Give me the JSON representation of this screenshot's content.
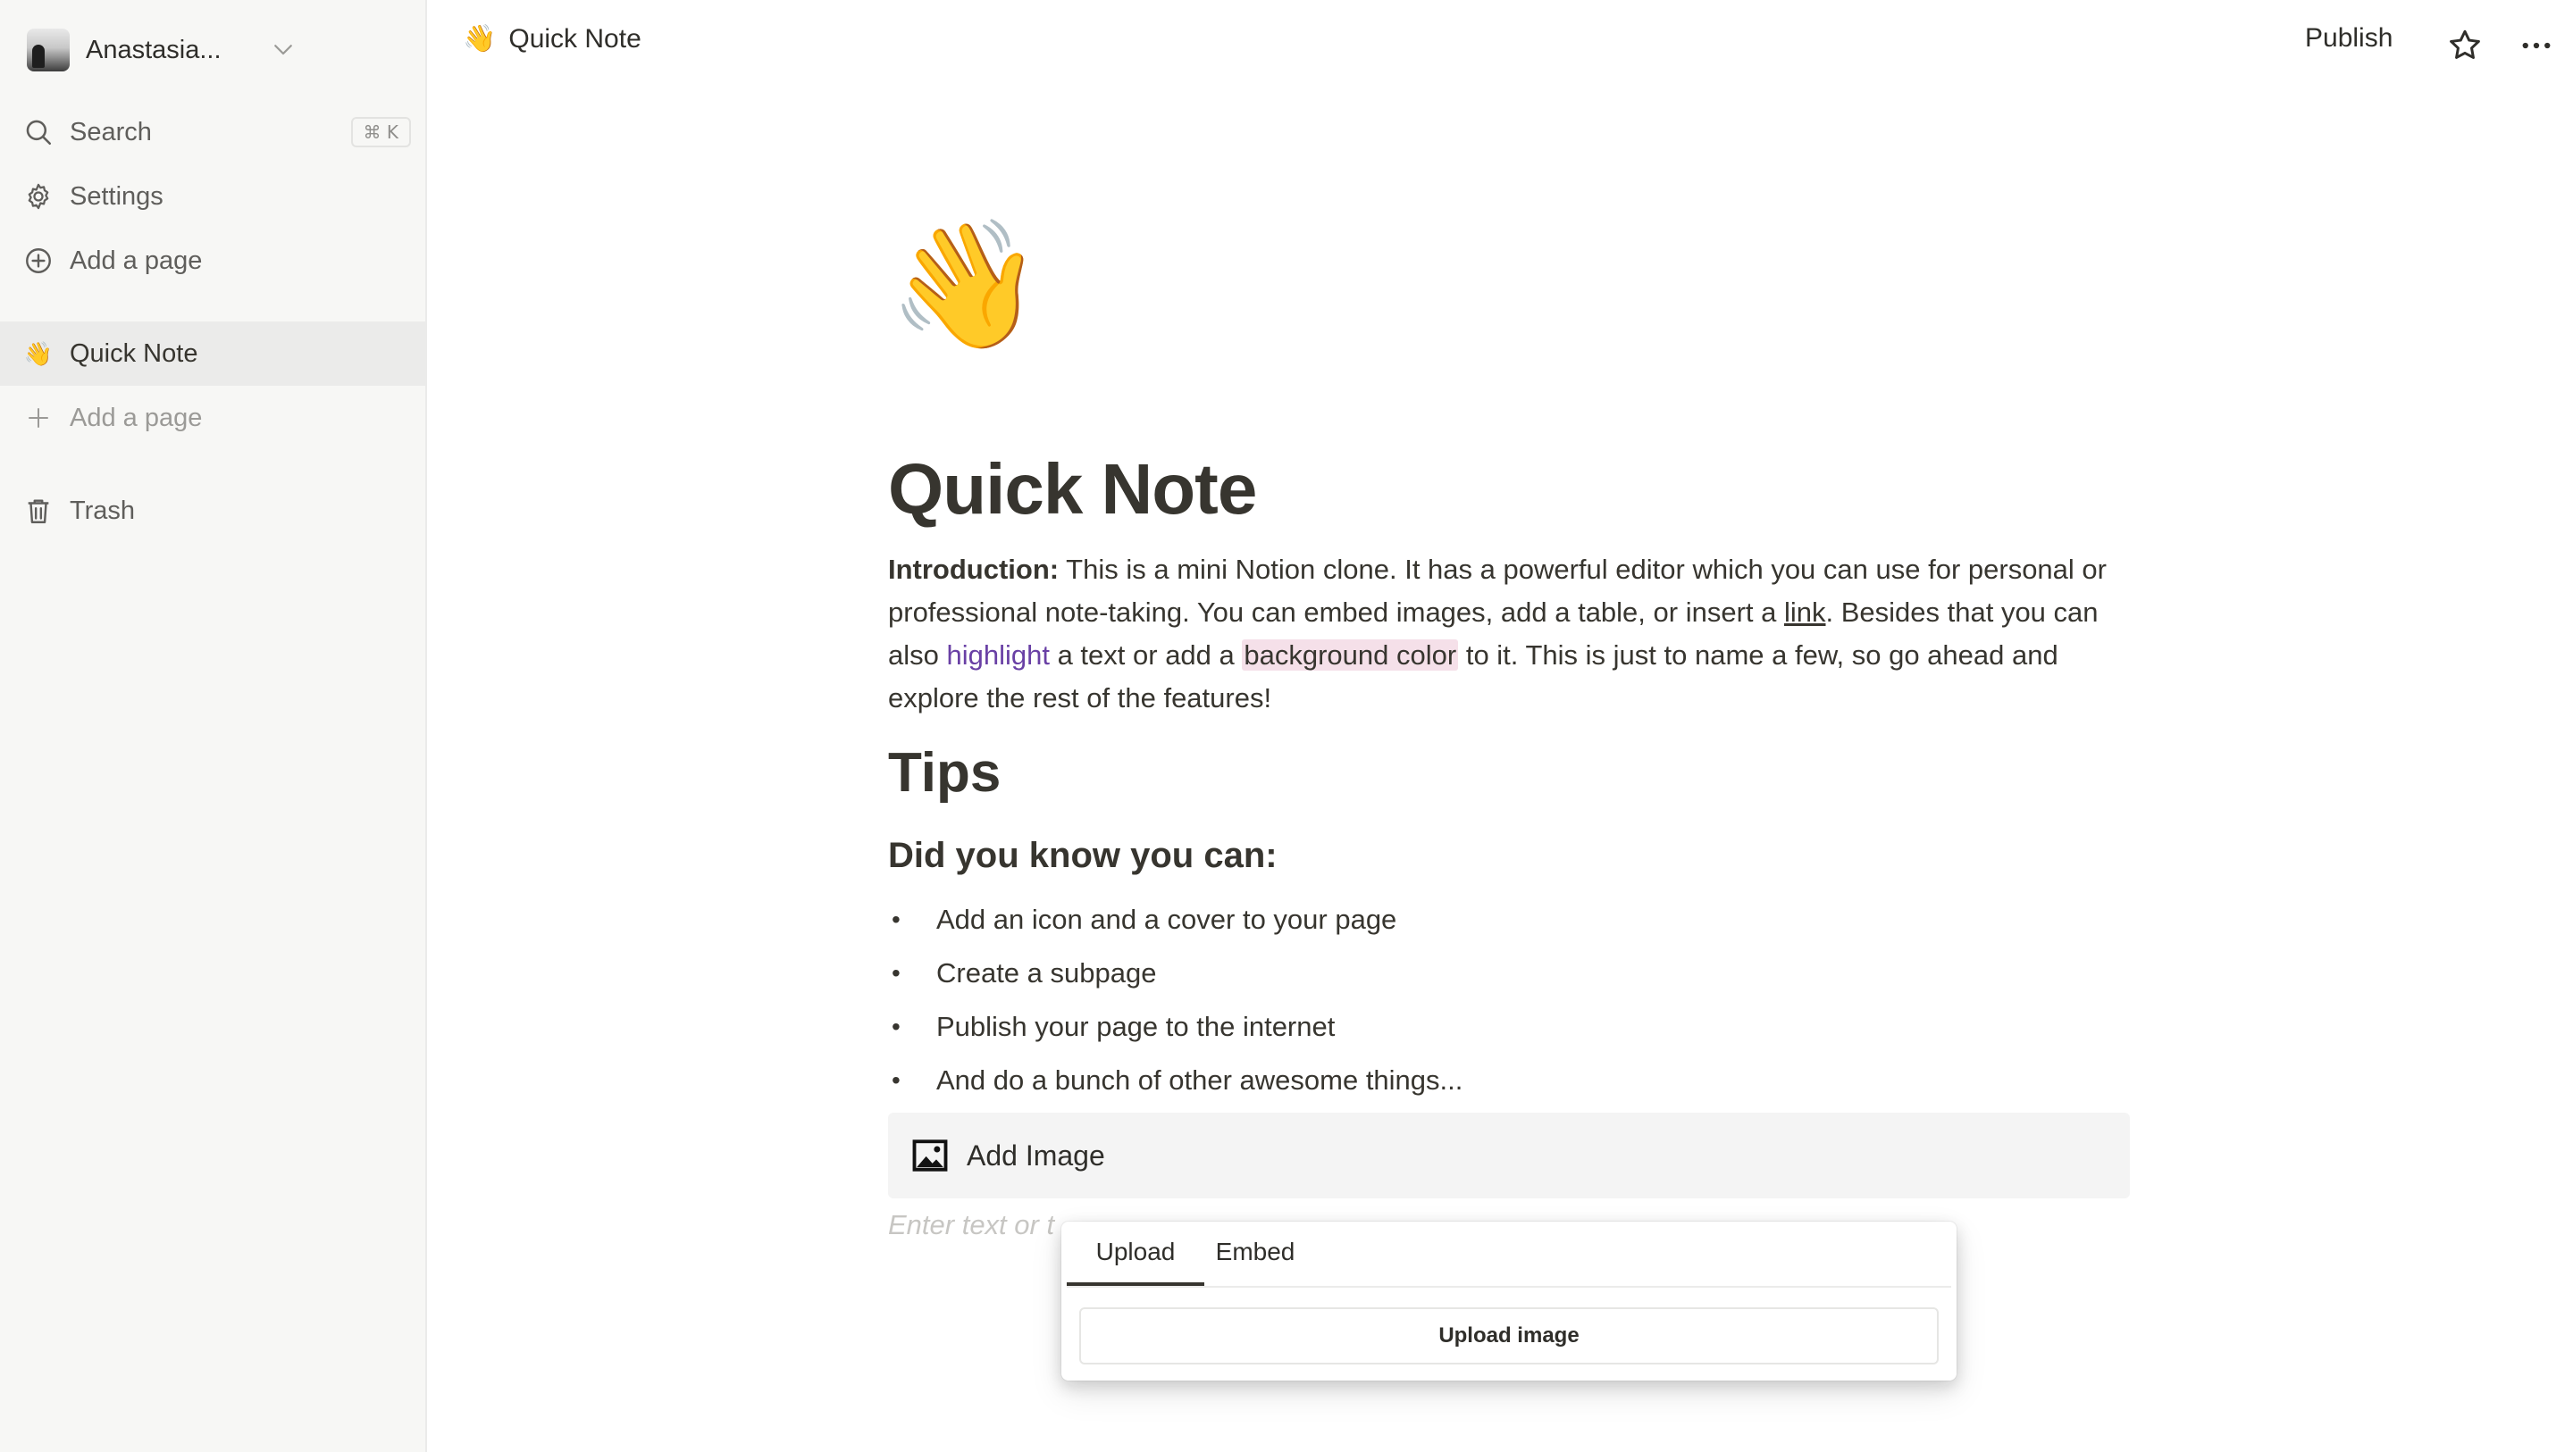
{
  "workspace": {
    "name": "Anastasia..."
  },
  "sidebar": {
    "search": {
      "label": "Search",
      "shortcut": "⌘ K"
    },
    "settings": {
      "label": "Settings"
    },
    "add_page_top": {
      "label": "Add a page"
    },
    "pages": [
      {
        "emoji": "👋",
        "label": "Quick Note"
      }
    ],
    "add_page": {
      "label": "Add a page"
    },
    "trash": {
      "label": "Trash"
    }
  },
  "topbar": {
    "breadcrumb": {
      "emoji": "👋",
      "title": "Quick Note"
    },
    "publish_label": "Publish",
    "star_icon": "star-icon",
    "more_icon": "more-horizontal-icon"
  },
  "page": {
    "icon": "👋",
    "title": "Quick Note",
    "intro": {
      "bold": "Introduction:",
      "part1": " This is a mini Notion clone. It has a powerful editor which you can use for personal or professional note-taking. You can embed images, add a table, or insert a ",
      "link": "link",
      "part2": ". Besides that you can also ",
      "highlight": "highlight",
      "part3": " a text or add a ",
      "background": "background color",
      "part4": " to it. This is just to name a few, so go ahead and explore the rest of the features!"
    },
    "heading1": "Tips",
    "heading2": "Did you know you can:",
    "bullets": [
      "Add an icon and a cover to your page",
      "Create a subpage",
      "Publish your page to the internet",
      "And do a bunch of other awesome things..."
    ],
    "add_image_label": "Add Image",
    "placeholder": "Enter text or t"
  },
  "popover": {
    "tabs": [
      "Upload",
      "Embed"
    ],
    "active_tab": "Upload",
    "button_label": "Upload image"
  },
  "colors": {
    "highlight_text": "#6940a5",
    "background_highlight": "#f5e0e9",
    "sidebar_bg": "#f7f7f5"
  }
}
